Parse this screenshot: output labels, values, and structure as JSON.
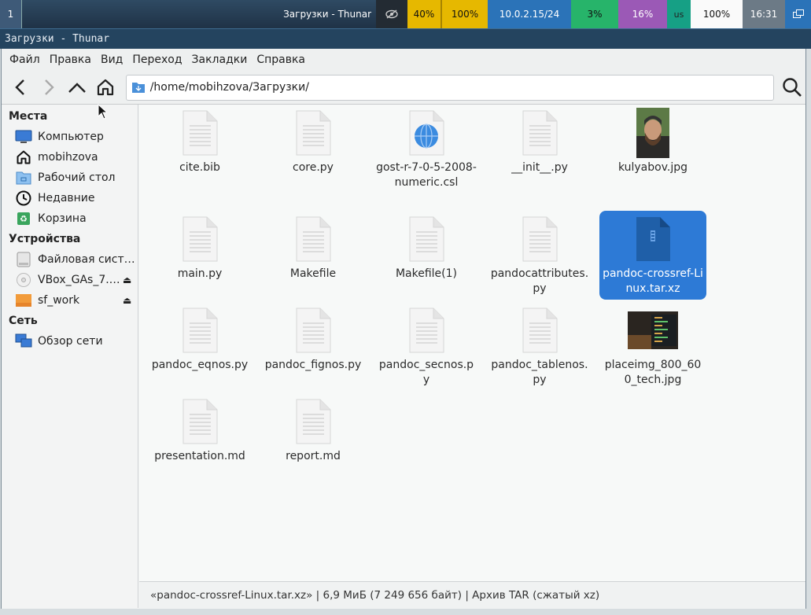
{
  "topbar": {
    "workspace": "1",
    "title": "Загрузки - Thunar",
    "cpu_volume": "40%",
    "brightness": "100%",
    "network": "10.0.2.15/24",
    "cpu_load": "3%",
    "mem": "16%",
    "layout": "us",
    "battery": "100%",
    "clock": "16:31"
  },
  "window": {
    "title": "Загрузки - Thunar"
  },
  "menu": [
    "Файл",
    "Правка",
    "Вид",
    "Переход",
    "Закладки",
    "Справка"
  ],
  "path": "/home/mobihzova/Загрузки/",
  "sidebar": {
    "places_header": "Места",
    "places": [
      {
        "label": "Компьютер",
        "icon": "computer-icon"
      },
      {
        "label": "mobihzova",
        "icon": "home-icon"
      },
      {
        "label": "Рабочий стол",
        "icon": "desktop-folder-icon"
      },
      {
        "label": "Недавние",
        "icon": "clock-icon"
      },
      {
        "label": "Корзина",
        "icon": "trash-icon"
      }
    ],
    "devices_header": "Устройства",
    "devices": [
      {
        "label": "Файловая систе…",
        "icon": "drive-icon"
      },
      {
        "label": "VBox_GAs_7.…",
        "icon": "disc-icon"
      },
      {
        "label": "sf_work",
        "icon": "folder-icon"
      }
    ],
    "network_header": "Сеть",
    "network": [
      {
        "label": "Обзор сети",
        "icon": "network-icon"
      }
    ]
  },
  "files": [
    {
      "name": "cite.bib",
      "icon": "text-file-icon"
    },
    {
      "name": "core.py",
      "icon": "text-file-icon"
    },
    {
      "name": "gost-r-7-0-5-2008-numeric.csl",
      "icon": "web-file-icon"
    },
    {
      "name": "__init__.py",
      "icon": "text-file-icon"
    },
    {
      "name": "kulyabov.jpg",
      "icon": "image-thumbnail-icon"
    },
    {
      "name": "main.py",
      "icon": "text-file-icon"
    },
    {
      "name": "Makefile",
      "icon": "text-file-icon"
    },
    {
      "name": "Makefile(1)",
      "icon": "text-file-icon"
    },
    {
      "name": "pandocattributes.py",
      "icon": "text-file-icon"
    },
    {
      "name": "pandoc-crossref-Linux.tar.xz",
      "icon": "archive-file-icon",
      "selected": true
    },
    {
      "name": "pandoc_eqnos.py",
      "icon": "text-file-icon"
    },
    {
      "name": "pandoc_fignos.py",
      "icon": "text-file-icon"
    },
    {
      "name": "pandoc_secnos.py",
      "icon": "text-file-icon"
    },
    {
      "name": "pandoc_tablenos.py",
      "icon": "text-file-icon"
    },
    {
      "name": "placeimg_800_600_tech.jpg",
      "icon": "image-thumbnail-icon"
    },
    {
      "name": "presentation.md",
      "icon": "text-file-icon"
    },
    {
      "name": "report.md",
      "icon": "text-file-icon"
    }
  ],
  "status": "«pandoc-crossref-Linux.tar.xz» | 6,9 МиБ (7 249 656 байт) | Архив TAR (сжатый xz)",
  "colors": {
    "selection": "#2d7ad6",
    "titlebar": "#24445f"
  }
}
